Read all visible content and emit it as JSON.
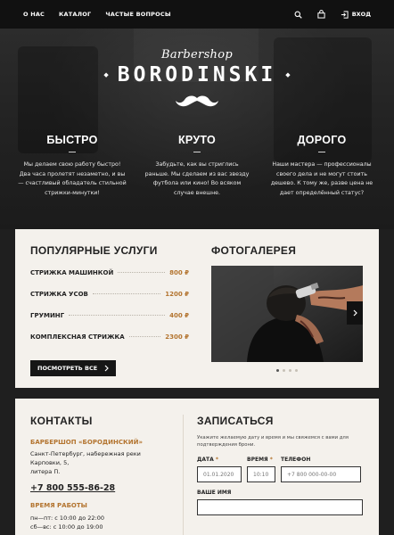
{
  "nav": {
    "items": [
      "О НАС",
      "КАТАЛОГ",
      "ЧАСТЫЕ ВОПРОСЫ"
    ],
    "login_label": "ВХОД"
  },
  "hero": {
    "logo_script": "Barbershop",
    "logo_name": "BORODINSKI",
    "features": [
      {
        "title": "БЫСТРО",
        "text": "Мы делаем свою работу быстро! Два часа пролетят незаметно, и вы — счастливый обладатель стильной стрижки-минутки!"
      },
      {
        "title": "КРУТО",
        "text": "Забудьте, как вы стриглись раньше. Мы сделаем из вас звезду футбола или кино! Во всяком случае внешне."
      },
      {
        "title": "ДОРОГО",
        "text": "Наши мастера — профессионалы своего дела и не могут стоить дешево. К тому же, разве цена не дает определённый статус?"
      }
    ]
  },
  "services": {
    "title": "ПОПУЛЯРНЫЕ УСЛУГИ",
    "items": [
      {
        "name": "СТРИЖКА МАШИНКОЙ",
        "price": "800 ₽"
      },
      {
        "name": "СТРИЖКА УСОВ",
        "price": "1200 ₽"
      },
      {
        "name": "ГРУМИНГ",
        "price": "400 ₽"
      },
      {
        "name": "КОМПЛЕКСНАЯ СТРИЖКА",
        "price": "2300 ₽"
      }
    ],
    "button_label": "ПОСМОТРЕТЬ ВСЕ"
  },
  "gallery": {
    "title": "ФОТОГАЛЕРЕЯ",
    "slide_count": 4,
    "active_slide": 1
  },
  "contacts": {
    "title": "КОНТАКТЫ",
    "company": "БАРБЕРШОП «БОРОДИНСКИЙ»",
    "address_line1": "Санкт-Петербург, набережная реки Карповки, 5,",
    "address_line2": "литера П.",
    "phone": "+7 800 555-86-28",
    "hours_title": "ВРЕМЯ РАБОТЫ",
    "hours_weekdays": "пн—пт: с 10:00 до 22:00",
    "hours_weekend": "сб—вс: с 10:00 до 19:00"
  },
  "booking": {
    "title": "ЗАПИСАТЬСЯ",
    "note_line1": "Укажите желаемую дату и время и мы свяжемся с вами для",
    "note_line2": "подтверждения брони.",
    "date_label": "ДАТА",
    "date_placeholder": "01.01.2020",
    "time_label": "ВРЕМЯ",
    "time_placeholder": "10:10",
    "phone_label": "ТЕЛЕФОН",
    "phone_placeholder": "+7 800 000-00-00",
    "name_label": "ВАШЕ ИМЯ",
    "required_mark": "*"
  },
  "colors": {
    "accent": "#b3742f",
    "dark": "#161616",
    "card_bg": "#f4f1ec"
  }
}
